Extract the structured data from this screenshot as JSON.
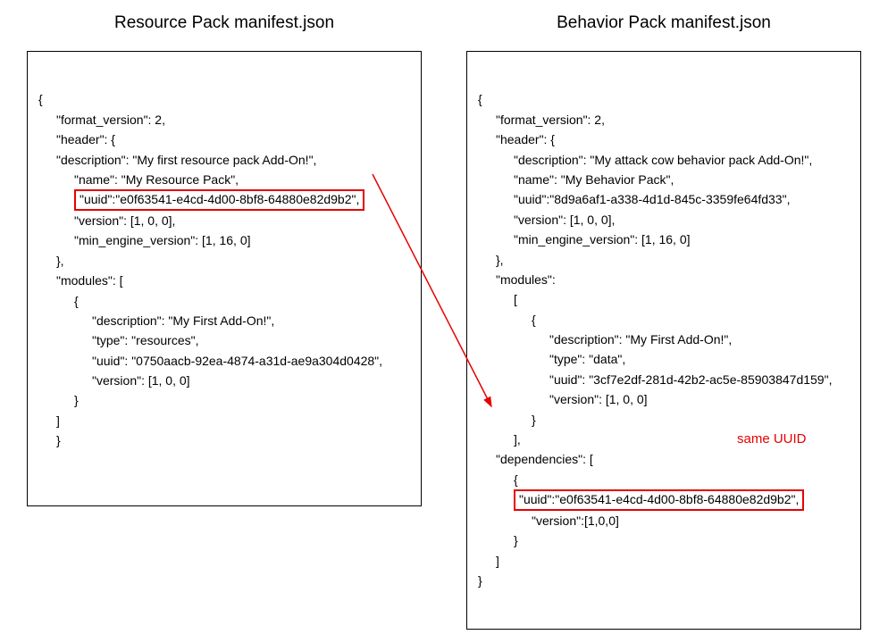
{
  "left": {
    "title": "Resource Pack manifest.json",
    "lines": {
      "l0": "{",
      "l1": "\"format_version\": 2,",
      "l2": "\"header\": {",
      "l3": "\"description\": \"My first resource pack Add-On!\",",
      "l4": "\"name\": \"My Resource Pack\",",
      "l5_uuid": "\"uuid\":\"e0f63541-e4cd-4d00-8bf8-64880e82d9b2\",",
      "l6": "\"version\": [1, 0, 0],",
      "l7": "\"min_engine_version\": [1, 16, 0]",
      "l8": "},",
      "l9": "\"modules\": [",
      "l10": "{",
      "l11": "\"description\": \"My First Add-On!\",",
      "l12": "\"type\": \"resources\",",
      "l13": "\"uuid\": \"0750aacb-92ea-4874-a31d-ae9a304d0428\",",
      "l14": "\"version\": [1, 0, 0]",
      "l15": "}",
      "l16": "]",
      "l17": "}"
    }
  },
  "right": {
    "title": "Behavior Pack manifest.json",
    "lines": {
      "r0": "{",
      "r1": "\"format_version\": 2,",
      "r2": "\"header\": {",
      "r3": "\"description\": \"My attack cow behavior pack Add-On!\",",
      "r4": "\"name\": \"My Behavior Pack\",",
      "r5": "\"uuid\":\"8d9a6af1-a338-4d1d-845c-3359fe64fd33\",",
      "r6": "\"version\": [1, 0, 0],",
      "r7": "\"min_engine_version\": [1, 16, 0]",
      "r8": "},",
      "r9": "\"modules\":",
      "r10": "[",
      "r11": "{",
      "r12": "\"description\": \"My First Add-On!\",",
      "r13": "\"type\": \"data\",",
      "r14": "\"uuid\": \"3cf7e2df-281d-42b2-ac5e-85903847d159\",",
      "r15": "\"version\": [1, 0, 0]",
      "r16": "}",
      "r17": "],",
      "r18": "\"dependencies\": [",
      "r19": "{",
      "r20_uuid": "\"uuid\":\"e0f63541-e4cd-4d00-8bf8-64880e82d9b2\",",
      "r21": "\"version\":[1,0,0]",
      "r22": "}",
      "r23": "]",
      "r24": "}"
    }
  },
  "annotation": "same UUID"
}
